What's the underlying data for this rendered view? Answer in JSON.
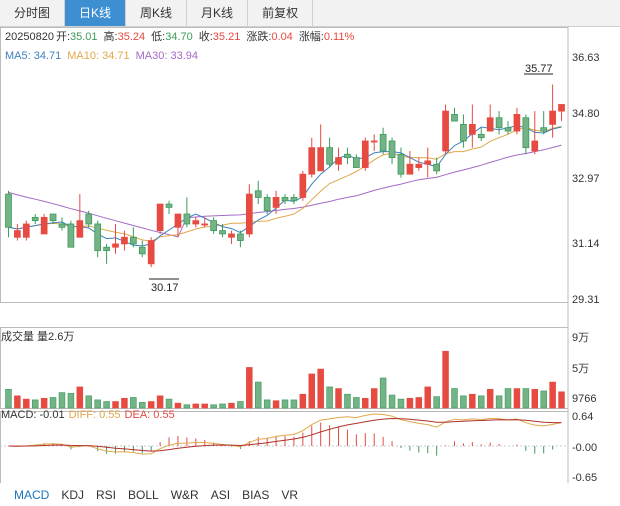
{
  "tabs": [
    {
      "label": "分时图",
      "active": false
    },
    {
      "label": "日K线",
      "active": true
    },
    {
      "label": "周K线",
      "active": false
    },
    {
      "label": "月K线",
      "active": false
    },
    {
      "label": "前复权",
      "active": false
    }
  ],
  "info": {
    "date": "20250820",
    "open_label": "开:",
    "open": "35.01",
    "high_label": "高:",
    "high": "35.24",
    "low_label": "低:",
    "low": "34.70",
    "close_label": "收:",
    "close": "35.21",
    "chg_label": "涨跌:",
    "chg": "0.04",
    "pct_label": "涨幅:",
    "pct": "0.11%"
  },
  "ma": {
    "ma5_label": "MA5: 34.71",
    "ma10_label": "MA10: 34.71",
    "ma30_label": "MA30: 33.94"
  },
  "colors": {
    "up": "#e64a40",
    "down": "#3a9a5a",
    "down_fill": "#74b386",
    "ma5": "#3f7fbf",
    "ma10": "#e0a84a",
    "ma30": "#a569c8",
    "axis": "#bbbbbb"
  },
  "price_axis": {
    "labels": [
      "36.63",
      "34.80",
      "32.97",
      "31.14",
      "29.31"
    ],
    "values": [
      36.63,
      34.8,
      32.97,
      31.14,
      29.31
    ]
  },
  "annotations": {
    "high": "35.77",
    "low": "30.17"
  },
  "volume": {
    "title": "成交量 量2.6万",
    "axis_labels": [
      "9万",
      "5万",
      "9766"
    ]
  },
  "macd": {
    "label": "MACD: -0.01",
    "diff_label": "DIFF: 0.55",
    "dea_label": "DEA: 0.55",
    "axis_labels": [
      "0.64",
      "-0.00",
      "-0.65"
    ]
  },
  "indicator_tabs": [
    {
      "label": "MACD",
      "active": true
    },
    {
      "label": "KDJ",
      "active": false
    },
    {
      "label": "RSI",
      "active": false
    },
    {
      "label": "BOLL",
      "active": false
    },
    {
      "label": "W&R",
      "active": false
    },
    {
      "label": "ASI",
      "active": false
    },
    {
      "label": "BIAS",
      "active": false
    },
    {
      "label": "VR",
      "active": false
    }
  ],
  "chart_data": {
    "type": "candlestick",
    "ylim": [
      29.31,
      36.63
    ],
    "candles": [
      [
        32.5,
        32.6,
        31.2,
        31.5
      ],
      [
        31.2,
        31.6,
        31.1,
        31.4
      ],
      [
        31.2,
        31.7,
        31.1,
        31.6
      ],
      [
        31.8,
        31.9,
        31.6,
        31.7
      ],
      [
        31.3,
        31.9,
        31.3,
        31.8
      ],
      [
        31.9,
        31.9,
        31.6,
        31.7
      ],
      [
        31.6,
        31.8,
        31.4,
        31.5
      ],
      [
        31.6,
        31.7,
        30.9,
        30.9
      ],
      [
        31.2,
        32.5,
        31.2,
        31.7
      ],
      [
        31.9,
        32.0,
        31.5,
        31.6
      ],
      [
        31.6,
        31.7,
        30.6,
        30.8
      ],
      [
        30.9,
        31.0,
        30.4,
        30.8
      ],
      [
        30.9,
        31.6,
        30.7,
        31.0
      ],
      [
        31.0,
        31.4,
        30.8,
        31.2
      ],
      [
        31.2,
        31.5,
        30.9,
        31.0
      ],
      [
        30.9,
        31.1,
        30.6,
        30.7
      ],
      [
        30.4,
        31.2,
        30.3,
        31.1
      ],
      [
        31.4,
        32.2,
        31.3,
        32.2
      ],
      [
        32.2,
        32.3,
        31.9,
        32.1
      ],
      [
        31.5,
        31.9,
        31.2,
        31.9
      ],
      [
        31.9,
        32.4,
        31.5,
        31.6
      ],
      [
        31.6,
        31.8,
        31.5,
        31.7
      ],
      [
        31.6,
        31.8,
        31.5,
        31.6
      ],
      [
        31.7,
        31.8,
        31.3,
        31.4
      ],
      [
        31.4,
        31.6,
        31.2,
        31.3
      ],
      [
        31.2,
        31.4,
        31.0,
        31.3
      ],
      [
        31.3,
        31.4,
        30.9,
        31.1
      ],
      [
        31.3,
        32.8,
        31.2,
        32.5
      ],
      [
        32.6,
        32.9,
        32.2,
        32.4
      ],
      [
        32.4,
        32.5,
        31.9,
        32.0
      ],
      [
        32.1,
        32.6,
        31.9,
        32.4
      ],
      [
        32.4,
        32.5,
        32.2,
        32.3
      ],
      [
        32.4,
        32.5,
        32.2,
        32.3
      ],
      [
        32.4,
        33.2,
        32.3,
        33.1
      ],
      [
        33.1,
        34.2,
        33.0,
        33.9
      ],
      [
        33.2,
        34.6,
        33.2,
        33.9
      ],
      [
        33.9,
        34.2,
        33.3,
        33.4
      ],
      [
        33.4,
        33.9,
        33.2,
        33.6
      ],
      [
        33.7,
        33.9,
        33.4,
        33.6
      ],
      [
        33.6,
        33.7,
        33.3,
        33.3
      ],
      [
        33.3,
        34.2,
        33.2,
        34.1
      ],
      [
        34.1,
        34.3,
        33.8,
        34.1
      ],
      [
        34.3,
        34.5,
        33.7,
        33.8
      ],
      [
        34.1,
        34.2,
        33.4,
        33.6
      ],
      [
        33.7,
        33.9,
        33.0,
        33.1
      ],
      [
        33.1,
        33.8,
        33.1,
        33.4
      ],
      [
        33.3,
        33.6,
        33.2,
        33.4
      ],
      [
        33.4,
        33.9,
        33.0,
        33.5
      ],
      [
        33.4,
        33.6,
        33.1,
        33.2
      ],
      [
        33.8,
        35.2,
        33.7,
        35.0
      ],
      [
        34.9,
        35.1,
        34.7,
        34.7
      ],
      [
        34.6,
        34.9,
        33.9,
        34.1
      ],
      [
        34.3,
        35.2,
        33.9,
        34.6
      ],
      [
        34.3,
        34.5,
        34.1,
        34.2
      ],
      [
        34.4,
        35.2,
        34.4,
        34.8
      ],
      [
        34.8,
        35.0,
        34.3,
        34.5
      ],
      [
        34.5,
        34.7,
        34.3,
        34.4
      ],
      [
        34.4,
        35.1,
        34.3,
        34.9
      ],
      [
        34.8,
        34.9,
        33.7,
        33.9
      ],
      [
        33.8,
        35.0,
        33.7,
        34.1
      ],
      [
        34.5,
        35.0,
        34.3,
        34.4
      ],
      [
        34.6,
        35.8,
        34.2,
        35.0
      ],
      [
        35.0,
        35.2,
        34.7,
        35.2
      ]
    ],
    "volumes_wan": [
      2.3,
      1.5,
      1.1,
      1.0,
      1.2,
      1.3,
      1.9,
      1.8,
      2.6,
      1.5,
      1.0,
      0.8,
      0.8,
      1.2,
      1.3,
      0.7,
      0.8,
      1.5,
      1.1,
      0.6,
      0.4,
      0.5,
      0.5,
      0.4,
      0.5,
      0.6,
      0.8,
      5.0,
      3.2,
      1.0,
      0.9,
      1.0,
      1.0,
      1.7,
      4.2,
      4.8,
      2.6,
      2.4,
      1.7,
      1.3,
      1.2,
      2.4,
      3.7,
      1.6,
      1.1,
      1.2,
      1.3,
      2.6,
      1.4,
      7.0,
      2.4,
      1.5,
      1.7,
      1.5,
      2.3,
      1.5,
      2.4,
      2.4,
      2.4,
      2.3,
      2.1,
      3.2,
      2.0
    ],
    "ma30_hint": "MA30 rising from ~31.1 to 33.94"
  }
}
